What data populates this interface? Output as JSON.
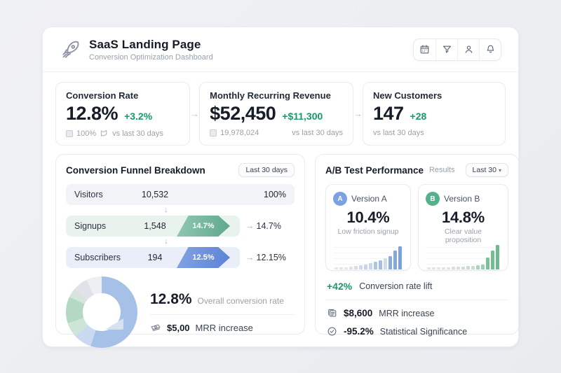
{
  "colors": {
    "green": "#17996a",
    "dark": "#161d29",
    "muted": "#99a1ac",
    "body-text": "#3a4452",
    "border": "#e9ebef",
    "row-visitors": "#f2f3f6",
    "row-signups": "#e9f3ee",
    "row-subscribers": "#e9eef8",
    "chevron-teal-a": "#92c9b3",
    "chevron-teal-b": "#5ea78c",
    "chevron-blue-a": "#84a3e4",
    "chevron-blue-b": "#5b82d6",
    "badge-a": "#7ba0e3",
    "badge-b": "#52b28c"
  },
  "header": {
    "title": "SaaS Landing Page",
    "subtitle": "Conversion Optimization Dashboard",
    "toolbar_icons": [
      "calendar-icon",
      "filter-icon",
      "user-icon",
      "bell-icon"
    ]
  },
  "stats": {
    "cards": [
      {
        "label": "Conversion Rate",
        "value": "12.8%",
        "delta": "+3.2%",
        "badge": "100%",
        "note": "vs last 30 days"
      },
      {
        "label": "Monthly Recurring Revenue",
        "value": "$52,450",
        "delta": "+$11,300",
        "badge": "19,978,024",
        "note": "vs last 30 days"
      },
      {
        "label": "New Customers",
        "value": "147",
        "delta": "+28",
        "note": "vs last 30 days"
      }
    ],
    "flow_arrow": "→"
  },
  "funnel": {
    "title": "Conversion Funnel Breakdown",
    "range_button": "Last 30 days",
    "down_arrow": "↓",
    "out_arrow": "→",
    "rows": [
      {
        "label": "Visitors",
        "value": "10,532",
        "rate": "100%"
      },
      {
        "label": "Signups",
        "value": "1,548",
        "chevron": "14.7%",
        "rate": "14.7%"
      },
      {
        "label": "Subscribers",
        "value": "194",
        "chevron": "12.5%",
        "rate": "12.15%"
      }
    ],
    "overall": {
      "value": "12.8%",
      "label": "Overall conversion rate"
    },
    "mrr": {
      "value": "$5,00",
      "label": "MRR increase"
    },
    "donut": {
      "type": "donut",
      "segments": [
        {
          "name": "blue",
          "color": "#a5c1e8",
          "pct": 55
        },
        {
          "name": "pale-blue",
          "color": "#c8d9f0",
          "pct": 8
        },
        {
          "name": "pale-green",
          "color": "#cde5d6",
          "pct": 7
        },
        {
          "name": "green",
          "color": "#b5d8c3",
          "pct": 12
        },
        {
          "name": "pale-sage",
          "color": "#d7e4db",
          "pct": 4
        },
        {
          "name": "gray",
          "color": "#dfe3e9",
          "pct": 7
        },
        {
          "name": "pale-gray",
          "color": "#edeff2",
          "pct": 7
        }
      ]
    }
  },
  "ab_test": {
    "title": "A/B Test Performance",
    "results_label": "Results",
    "range_button": "Last 30",
    "caret": "▾",
    "versions": [
      {
        "badge": "A",
        "name": "Version A",
        "value": "10.4%",
        "desc": "Low friction signup",
        "bars": {
          "type": "bar",
          "heights": [
            3,
            3,
            3,
            4,
            5,
            6,
            7,
            9,
            11,
            13,
            16,
            19,
            27,
            33
          ],
          "colors": [
            "#e3e7ed",
            "#e3e7ed",
            "#e3e7ed",
            "#dde3eb",
            "#d6deea",
            "#cfd9e9",
            "#c7d4e8",
            "#c9d6eb",
            "#b1c4e5",
            "#a5bce3",
            "#d4dce6",
            "#8badde",
            "#84a7dc",
            "#7da2da"
          ]
        }
      },
      {
        "badge": "B",
        "name": "Version B",
        "value": "14.8%",
        "desc": "Clear value proposition",
        "bars": {
          "type": "bar",
          "heights": [
            3,
            3,
            3,
            3,
            3,
            4,
            4,
            4,
            5,
            5,
            6,
            7,
            17,
            27,
            35
          ],
          "colors": [
            "#e2e6e4",
            "#e2e6e4",
            "#e2e6e4",
            "#e0e5e2",
            "#dde4e0",
            "#d9e2dd",
            "#d4e0d9",
            "#cedcd4",
            "#c6ddd0",
            "#c6ddd0",
            "#a9d2ba",
            "#9cccae",
            "#7cc09a",
            "#74bc94",
            "#6fb890"
          ]
        }
      }
    ],
    "lift": {
      "value": "+42%",
      "label": "Conversion rate lift"
    },
    "mrr": {
      "value": "$8,600",
      "label": "MRR increase"
    },
    "significance": {
      "value": "-95.2%",
      "label": "Statistical Significance"
    }
  }
}
